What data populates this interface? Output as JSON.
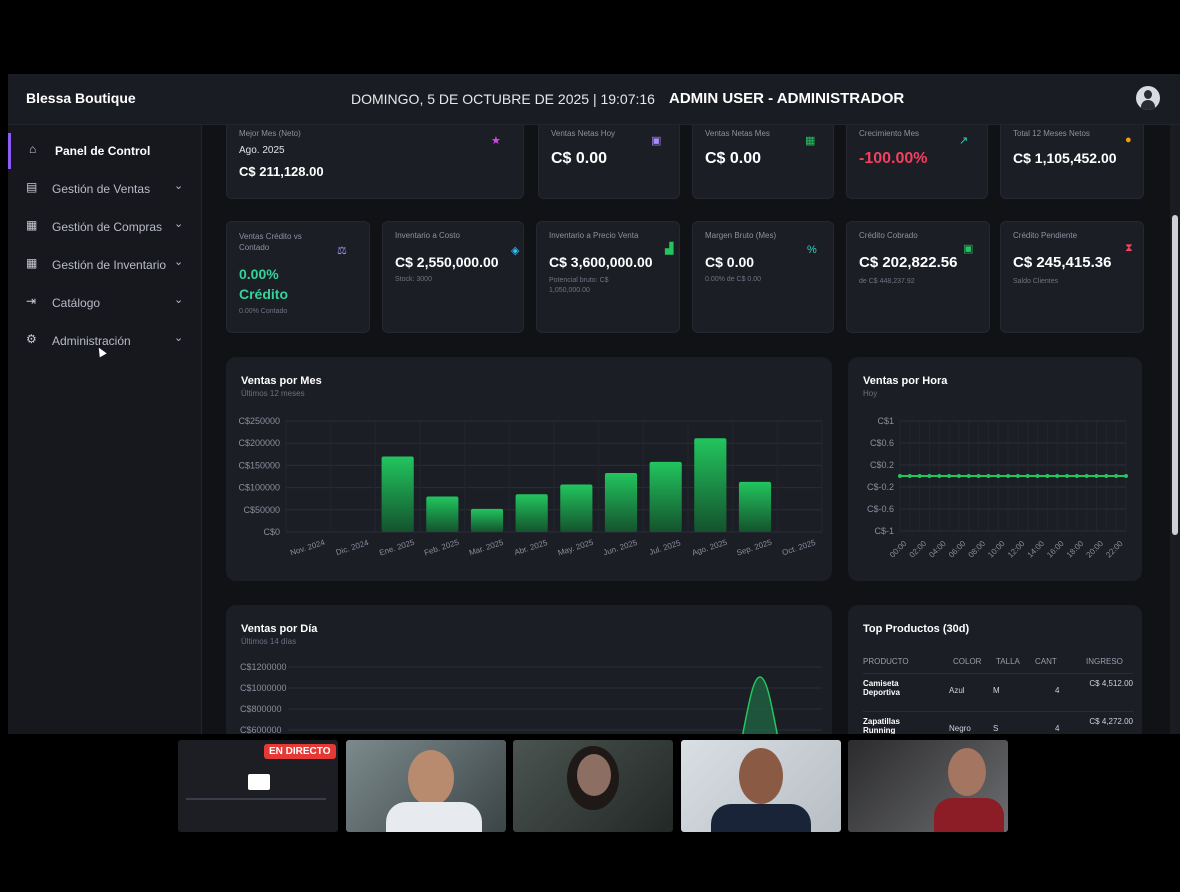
{
  "header": {
    "brand": "Blessa Boutique",
    "datetime": "DOMINGO, 5 DE OCTUBRE DE 2025  |  19:07:16",
    "user": "ADMIN USER - ADMINISTRADOR"
  },
  "sidebar": {
    "items": [
      {
        "label": "Panel de Control",
        "icon": "home-icon",
        "glyph": "⌂"
      },
      {
        "label": "Gestión de Ventas",
        "icon": "sales-icon",
        "glyph": "▤"
      },
      {
        "label": "Gestión de Compras",
        "icon": "purchases-icon",
        "glyph": "▦"
      },
      {
        "label": "Gestión de Inventario",
        "icon": "inventory-icon",
        "glyph": "▦"
      },
      {
        "label": "Catálogo",
        "icon": "catalog-icon",
        "glyph": "⇥"
      },
      {
        "label": "Administración",
        "icon": "gears-icon",
        "glyph": "⚙"
      }
    ],
    "chevron": "⌄"
  },
  "kpi_row1": [
    {
      "title": "Mejor Mes (Neto)",
      "sub": "Ago. 2025",
      "value": "C$ 211,128.00",
      "icon": "trophy-icon",
      "glyph": "🏆",
      "color": "#d946ef"
    },
    {
      "title": "Ventas Netas Hoy",
      "value": "C$ 0.00",
      "icon": "calendar-day-icon",
      "glyph": "▣",
      "color": "#a78bfa"
    },
    {
      "title": "Ventas Netas Mes",
      "value": "C$ 0.00",
      "icon": "calendar-month-icon",
      "glyph": "▦",
      "color": "#22c55e"
    },
    {
      "title": "Crecimiento Mes",
      "value": "-100.00%",
      "icon": "growth-chart-icon",
      "glyph": "↗",
      "color": "#2dd4bf",
      "value_color": "#f43f5e"
    },
    {
      "title": "Total 12 Meses Netos",
      "value": "C$ 1,105,452.00",
      "icon": "coins-icon",
      "glyph": "●",
      "color": "#f59e0b"
    }
  ],
  "kpi_row2": [
    {
      "title": "Ventas Crédito vs Contado",
      "value": "0.00%",
      "value2": "Crédito",
      "sub": "0.00% Contado",
      "icon": "balance-scale-icon",
      "glyph": "⚖",
      "color": "#a78bfa"
    },
    {
      "title": "Inventario a Costo",
      "value": "C$ 2,550,000.00",
      "sub": "Stock: 3000",
      "icon": "layers-icon",
      "glyph": "◈",
      "color": "#38bdf8"
    },
    {
      "title": "Inventario a Precio Venta",
      "value": "C$ 3,600,000.00",
      "sub": "Potencial bruto: C$ 1,050,000.00",
      "icon": "area-chart-icon",
      "glyph": "▟",
      "color": "#22c55e"
    },
    {
      "title": "Margen Bruto (Mes)",
      "value": "C$ 0.00",
      "sub": "0.00% de C$ 0.00",
      "icon": "percent-icon",
      "glyph": "%",
      "color": "#2dd4bf"
    },
    {
      "title": "Crédito Cobrado",
      "value": "C$ 202,822.56",
      "sub": "de C$ 448,237.92",
      "icon": "money-icon",
      "glyph": "▣",
      "color": "#22c55e"
    },
    {
      "title": "Crédito Pendiente",
      "value": "C$ 245,415.36",
      "sub": "Saldo Clientes",
      "icon": "hourglass-icon",
      "glyph": "⧗",
      "color": "#f43f5e"
    }
  ],
  "ventas_mes": {
    "title": "Ventas por Mes",
    "subtitle": "Últimos 12 meses"
  },
  "ventas_hora": {
    "title": "Ventas por Hora",
    "subtitle": "Hoy"
  },
  "ventas_dia": {
    "title": "Ventas por Día",
    "subtitle": "Últimos 14 días",
    "yticks": [
      "C$1200000",
      "C$1000000",
      "C$800000",
      "C$600000"
    ]
  },
  "top_productos": {
    "title": "Top Productos (30d)",
    "headers": [
      "PRODUCTO",
      "COLOR",
      "TALLA",
      "CANT",
      "INGRESO"
    ],
    "rows": [
      {
        "producto": "Camiseta Deportiva",
        "color": "Azul",
        "talla": "M",
        "cant": "4",
        "ingreso": "C$ 4,512.00"
      },
      {
        "producto": "Zapatillas Running",
        "color": "Negro",
        "talla": "S",
        "cant": "4",
        "ingreso": "C$ 4,272.00"
      }
    ]
  },
  "call": {
    "live_label": "EN DIRECTO"
  },
  "chart_data": [
    {
      "type": "bar",
      "title": "Ventas por Mes",
      "subtitle": "Últimos 12 meses",
      "categories": [
        "Nov. 2024",
        "Dic. 2024",
        "Ene. 2025",
        "Feb. 2025",
        "Mar. 2025",
        "Abr. 2025",
        "May. 2025",
        "Jun. 2025",
        "Jul. 2025",
        "Ago. 2025",
        "Sep. 2025",
        "Oct. 2025"
      ],
      "values": [
        0,
        0,
        170000,
        80000,
        52000,
        85000,
        107000,
        133000,
        158000,
        211128,
        113000,
        0
      ],
      "yticks": [
        "C$250000",
        "C$200000",
        "C$150000",
        "C$100000",
        "C$50000",
        "C$0"
      ],
      "ylim": [
        0,
        250000
      ],
      "grid": true,
      "color": "#22c55e"
    },
    {
      "type": "line",
      "title": "Ventas por Hora",
      "subtitle": "Hoy",
      "x": [
        "00:00",
        "01:00",
        "02:00",
        "03:00",
        "04:00",
        "05:00",
        "06:00",
        "07:00",
        "08:00",
        "09:00",
        "10:00",
        "11:00",
        "12:00",
        "13:00",
        "14:00",
        "15:00",
        "16:00",
        "17:00",
        "18:00",
        "19:00",
        "20:00",
        "21:00",
        "22:00",
        "23:00"
      ],
      "xticks": [
        "00:00",
        "02:00",
        "04:00",
        "06:00",
        "08:00",
        "10:00",
        "12:00",
        "14:00",
        "16:00",
        "18:00",
        "20:00",
        "22:00"
      ],
      "values": [
        0,
        0,
        0,
        0,
        0,
        0,
        0,
        0,
        0,
        0,
        0,
        0,
        0,
        0,
        0,
        0,
        0,
        0,
        0,
        0,
        0,
        0,
        0,
        0
      ],
      "yticks": [
        "C$1",
        "C$0.6",
        "C$0.2",
        "C$-0.2",
        "C$-0.6",
        "C$-1"
      ],
      "ylim": [
        -1,
        1
      ],
      "grid": true,
      "color": "#22c55e"
    }
  ]
}
